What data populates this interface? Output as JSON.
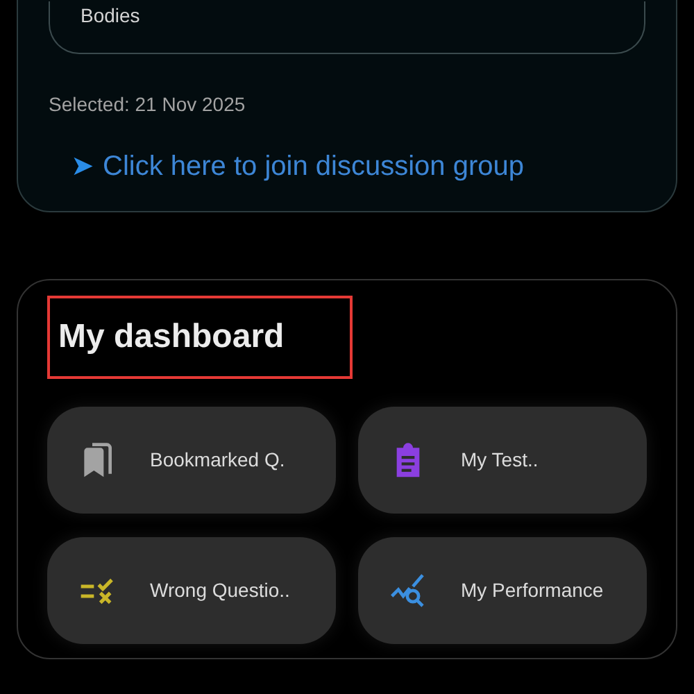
{
  "topic_card": {
    "breadcrumb": "Bodies",
    "selected_date": "Selected: 21 Nov 2025",
    "join_link": {
      "arrow": "➤",
      "label": "Click here to join discussion group"
    }
  },
  "dashboard": {
    "title": "My dashboard",
    "highlighted": true,
    "tiles": [
      {
        "kind": "bookmark",
        "label": "Bookmarked Q.",
        "color": "#a3a3a3"
      },
      {
        "kind": "test",
        "label": "My Test..",
        "color": "#8b3fe0"
      },
      {
        "kind": "wrong",
        "label": "Wrong Questio..",
        "color": "#c9b628"
      },
      {
        "kind": "performance",
        "label": "My Performance",
        "color": "#3b8fe0"
      }
    ]
  }
}
